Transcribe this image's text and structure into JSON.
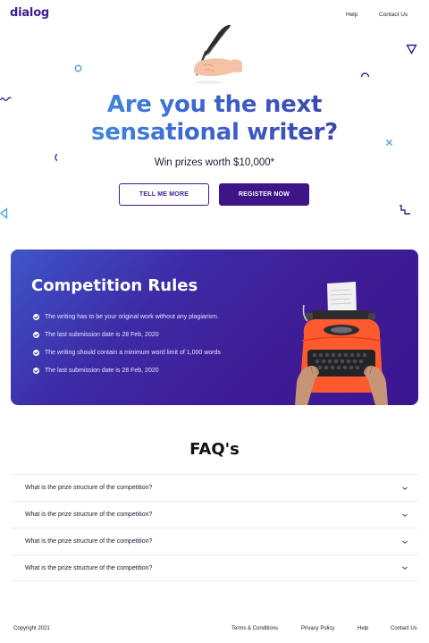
{
  "nav": {
    "logo": "dialog",
    "links": [
      "Help",
      "Contact Us"
    ]
  },
  "hero": {
    "title_line1": "Are you the next",
    "title_line2": "sensational writer?",
    "subtitle": "Win prizes worth $10,000*",
    "buttons": {
      "secondary": "TELL ME MORE",
      "primary": "REGISTER NOW"
    }
  },
  "rules": {
    "title": "Competition Rules",
    "items": [
      "The writing has to be your original work without any plagiarism.",
      "The last submission date is 28 Feb, 2020",
      "The writing should contain a minimum word limit of 1,000 words",
      "The last submission date is 28 Feb, 2020"
    ]
  },
  "faq": {
    "title": "FAQ's",
    "items": [
      "What is the prize structure of the competition?",
      "What is the prize structure of the competition?",
      "What is the prize structure of the competition?",
      "What is the prize structure of the competition?"
    ]
  },
  "footer": {
    "copyright": "Copyright 2021",
    "links": [
      "Terms & Conditions",
      "Privacy Policy",
      "Help",
      "Contact Us"
    ]
  },
  "colors": {
    "brand": "#3b1d8f",
    "title_gradient_start": "#48a4ea",
    "title_gradient_end": "#3a2f96",
    "rules_bg": "#3e1c95"
  }
}
